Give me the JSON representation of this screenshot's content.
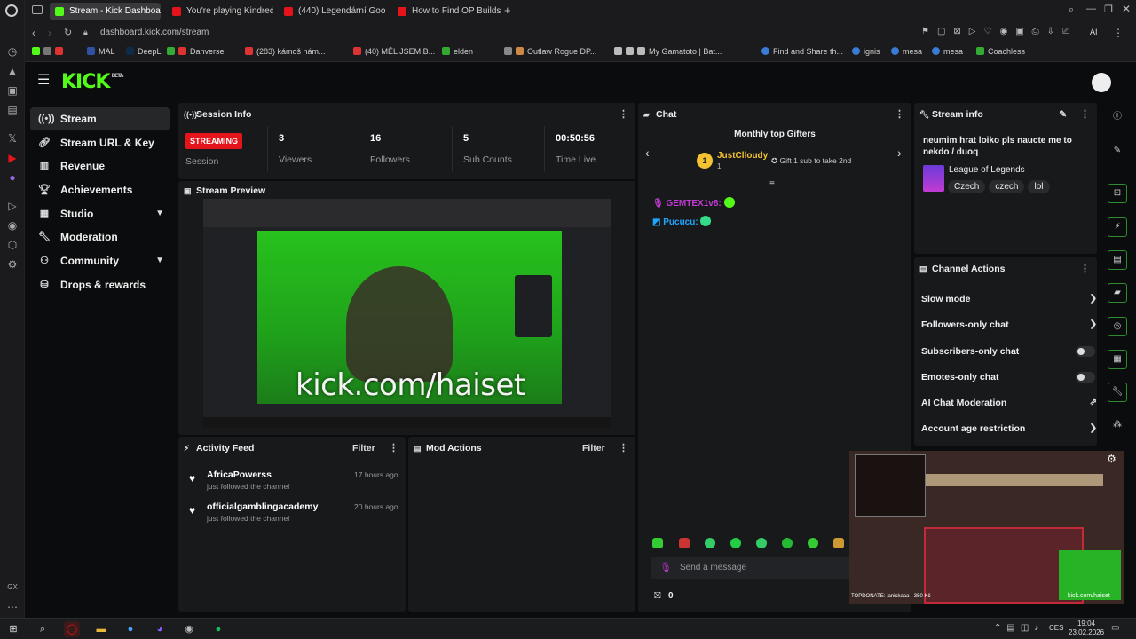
{
  "browser": {
    "tabs": [
      {
        "label": "Stream - Kick Dashboard",
        "color": "#53fc18",
        "active": true
      },
      {
        "label": "You're playing Kindred Co",
        "color": "#e5141b",
        "active": false
      },
      {
        "label": "(440) Legendární Goo",
        "color": "#e5141b",
        "active": false
      },
      {
        "label": "How to Find OP Builds Be",
        "color": "#e5141b",
        "active": false
      }
    ],
    "url": "dashboard.kick.com/stream",
    "bookmarks": [
      "MAL",
      "DeepL",
      "Danverse",
      "(283) kámoš nám...",
      "(40) MĚL JSEM B...",
      "elden",
      "Outlaw Rogue DP...",
      "My Gamatoto | Bat...",
      "Find and Share th...",
      "ignis",
      "mesa",
      "mesa",
      "Coachless"
    ]
  },
  "kick": {
    "logo": "KICK",
    "logo_badge": "BETA"
  },
  "nav": {
    "items": [
      {
        "label": "Stream",
        "icon": "broadcast-icon"
      },
      {
        "label": "Stream URL & Key",
        "icon": "link-icon"
      },
      {
        "label": "Revenue",
        "icon": "chart-icon"
      },
      {
        "label": "Achievements",
        "icon": "trophy-icon"
      },
      {
        "label": "Studio",
        "icon": "studio-icon"
      },
      {
        "label": "Moderation",
        "icon": "wrench-icon"
      },
      {
        "label": "Community",
        "icon": "community-icon"
      },
      {
        "label": "Drops & rewards",
        "icon": "drops-icon"
      }
    ]
  },
  "session": {
    "title": "Session Info",
    "badge": "STREAMING",
    "badge_label": "Session",
    "stats": [
      {
        "value": "3",
        "label": "Viewers"
      },
      {
        "value": "16",
        "label": "Followers"
      },
      {
        "value": "5",
        "label": "Sub Counts"
      },
      {
        "value": "00:50:56",
        "label": "Time Live"
      }
    ]
  },
  "preview": {
    "title": "Stream Preview",
    "overlay_text": "kick.com/haiset"
  },
  "activity": {
    "title": "Activity Feed",
    "filter": "Filter",
    "items": [
      {
        "name": "AfricaPowerss",
        "action": "just followed the channel",
        "time": "17 hours ago"
      },
      {
        "name": "officialgamblingacademy",
        "action": "just followed the channel",
        "time": "20 hours ago"
      }
    ]
  },
  "mod_actions": {
    "title": "Mod Actions",
    "filter": "Filter"
  },
  "chat": {
    "title": "Chat",
    "gifters_title": "Monthly top Gifters",
    "top_gifter": {
      "rank": "1",
      "name": "JustClloudy",
      "count": "1",
      "gift_text": "Gift 1 sub to take 2nd"
    },
    "messages": [
      {
        "user": "GEMTEX1v8",
        "color": "#c23bd4"
      },
      {
        "user": "Pucucu",
        "color": "#1fa6ff"
      }
    ],
    "input_placeholder": "Send a message",
    "count": "0"
  },
  "stream_info": {
    "title": "Stream info",
    "stream_title": "neumim hrat loiko pls naucte me to nekdo / duoq",
    "category": "League of Legends",
    "tags": [
      "Czech",
      "czech",
      "lol"
    ]
  },
  "channel_actions": {
    "title": "Channel Actions",
    "items": [
      {
        "label": "Slow mode",
        "kind": "chevron"
      },
      {
        "label": "Followers-only chat",
        "kind": "chevron"
      },
      {
        "label": "Subscribers-only chat",
        "kind": "toggle"
      },
      {
        "label": "Emotes-only chat",
        "kind": "toggle"
      },
      {
        "label": "AI Chat Moderation",
        "kind": "external"
      },
      {
        "label": "Account age restriction",
        "kind": "chevron"
      }
    ]
  },
  "game_overlay": {
    "caption": "kick.com/haiset",
    "donate": "TOPDONATE: janickaaa - 350 Kč"
  },
  "taskbar": {
    "lang": "CES",
    "time": "19:04",
    "date": "23.02.2026"
  }
}
